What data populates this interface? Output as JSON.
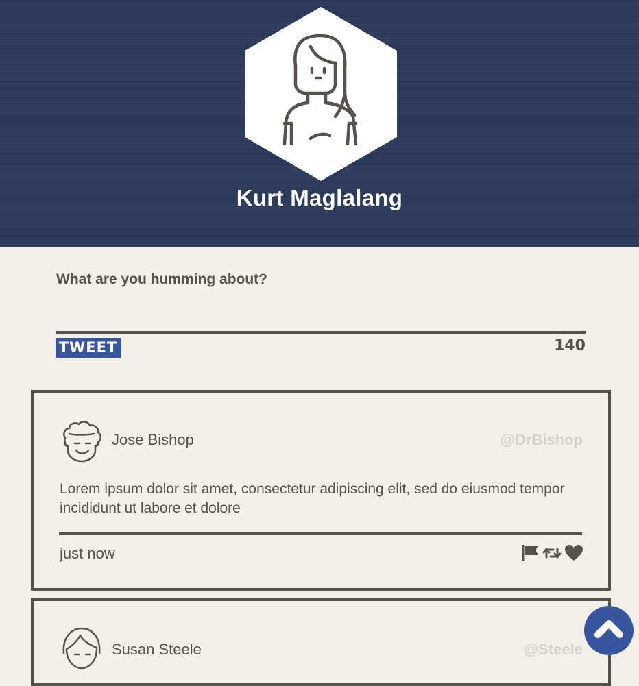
{
  "profile": {
    "name": "Kurt Maglalang",
    "avatar_icon": "woman-avatar-icon"
  },
  "compose": {
    "prompt": "What are you humming about?",
    "value": "",
    "placeholder": "",
    "submit_label": "Tweet",
    "char_count": "140"
  },
  "feed": [
    {
      "name": "Jose Bishop",
      "handle": "@DrBishop",
      "avatar_icon": "curly-hair-man-avatar-icon",
      "text": "Lorem ipsum dolor sit amet, consectetur adipiscing elit, sed do eiusmod tempor incididunt ut labore et dolore",
      "time": "just now",
      "actions": [
        "flag-icon",
        "retweet-icon",
        "heart-icon"
      ]
    },
    {
      "name": "Susan Steele",
      "handle": "@Steele",
      "avatar_icon": "short-hair-avatar-icon"
    }
  ],
  "colors": {
    "header_bg": "#2c3b5c",
    "page_bg": "#f3f0eb",
    "ink": "#57534c",
    "accent": "#3a55a0",
    "handle_muted": "#d6d2cb"
  },
  "scroll_top_icon": "chevron-up-icon"
}
